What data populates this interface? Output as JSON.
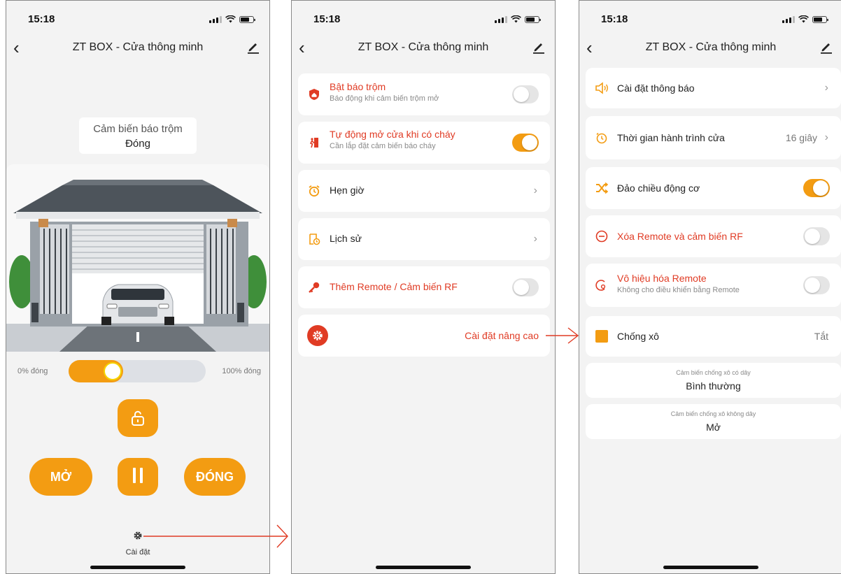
{
  "status": {
    "time": "15:18"
  },
  "nav": {
    "title": "ZT BOX - Cửa thông minh"
  },
  "screen_control": {
    "sensor_label": "Cảm biến báo trộm",
    "sensor_value": "Đóng",
    "slider_min_label": "0% đóng",
    "slider_max_label": "100% đóng",
    "slider_value_fraction": 0.4,
    "open_label": "MỞ",
    "close_label": "ĐÓNG",
    "settings_label": "Cài đặt"
  },
  "screen_settings": {
    "rows": [
      {
        "title": "Bật báo trộm",
        "subtitle": "Báo động khi cảm biến trộm mở",
        "toggle": false,
        "icon": "shield-home-icon"
      },
      {
        "title": "Tự động mở cửa khi có cháy",
        "subtitle": "Cần lắp đặt cảm biến báo cháy",
        "toggle": true,
        "icon": "exit-door-icon"
      },
      {
        "title": "Hẹn giờ",
        "icon": "alarm-clock-icon"
      },
      {
        "title": "Lịch sử",
        "icon": "history-icon"
      },
      {
        "title": "Thêm Remote / Cảm biến RF",
        "toggle": false,
        "icon": "key-icon"
      }
    ],
    "advanced_label": "Cài đặt nâng cao"
  },
  "screen_advanced": {
    "notification_label": "Cài đặt thông báo",
    "travel_time_label": "Thời gian hành trình cửa",
    "travel_time_value": "16 giây",
    "reverse_motor_label": "Đảo chiều động cơ",
    "reverse_motor_on": true,
    "delete_remote_label": "Xóa Remote và cảm biến RF",
    "delete_remote_on": false,
    "disable_remote_label": "Vô hiệu hóa Remote",
    "disable_remote_sub": "Không cho điều khiển bằng Remote",
    "disable_remote_on": false,
    "anti_pinch_label": "Chống xô",
    "anti_pinch_value": "Tắt",
    "wired_sensor_label": "Cảm biến chống xô có dây",
    "wired_sensor_value": "Bình thường",
    "wireless_sensor_label": "Cảm biến chống xô không dây",
    "wireless_sensor_value": "Mở"
  },
  "colors": {
    "accent": "#f39c12",
    "danger": "#e03b24",
    "arrow": "#e03b24"
  }
}
